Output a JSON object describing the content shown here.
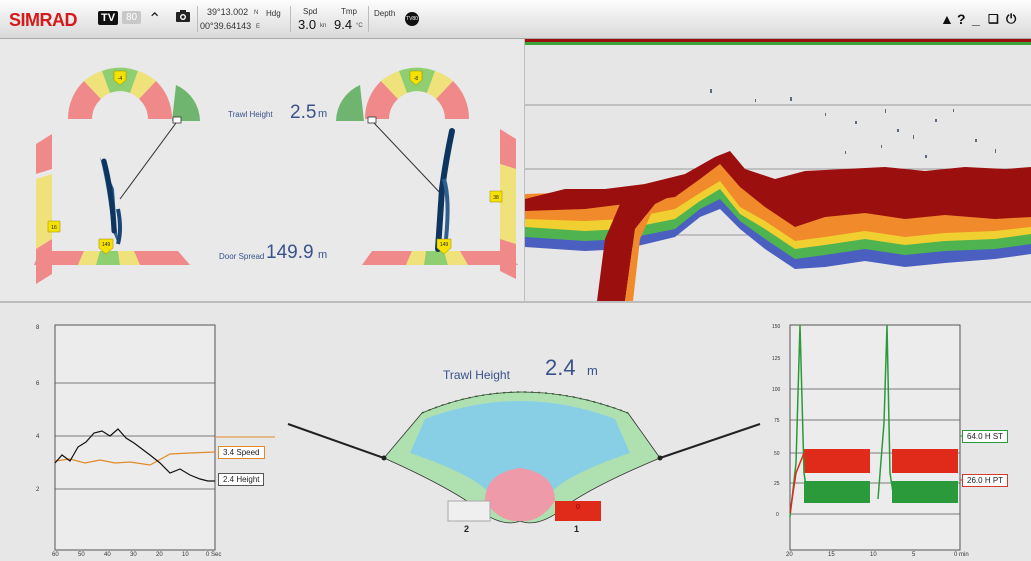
{
  "topbar": {
    "brand": "SIMRAD",
    "brand_badge": "TV",
    "brand_badge2": "80",
    "lat": "39°13.002",
    "lat_hem": "N",
    "lon": "00°39.64143",
    "lon_hem": "E",
    "hdg_label": "Hdg",
    "spd_label": "Spd",
    "spd_value": "3.0",
    "spd_unit": "kn",
    "tmp_label": "Tmp",
    "tmp_value": "9.4",
    "tmp_unit": "°C",
    "depth_label": "Depth",
    "depth_icon_text": "TV80",
    "icons": [
      "chevron-up-icon",
      "camera-icon",
      "warning-icon",
      "help-icon",
      "minimize-icon",
      "restore-icon",
      "power-icon"
    ]
  },
  "trawl_top": {
    "trawl_height_label": "Trawl Height",
    "trawl_height_value": "2.5",
    "trawl_height_unit": "m",
    "door_spread_label": "Door Spread",
    "door_spread_value": "149.9",
    "door_spread_unit": "m",
    "left_door": {
      "top_marker": "-4",
      "side_marker": "16",
      "bottom_marker": "149"
    },
    "right_door": {
      "top_marker": "-8",
      "side_marker": "38",
      "bottom_marker": "149"
    }
  },
  "history_left": {
    "y_ticks": [
      "8",
      "6",
      "4",
      "2"
    ],
    "x_ticks": [
      "60",
      "50",
      "40",
      "30",
      "20",
      "10",
      "0 Sec"
    ],
    "legend": [
      {
        "value": "3.4",
        "name": "Speed",
        "color": "#e08a2a"
      },
      {
        "value": "2.4",
        "name": "Height",
        "color": "#111111"
      }
    ]
  },
  "trawl_center": {
    "label": "Trawl Height",
    "value": "2.4",
    "unit": "m",
    "sensor_2_label": "2",
    "sensor_1_label": "1",
    "sensor_1_value": "0"
  },
  "history_right": {
    "y_ticks": [
      "150",
      "125",
      "100",
      "75",
      "50",
      "25",
      "0"
    ],
    "x_ticks": [
      "20",
      "15",
      "10",
      "5",
      "0 min"
    ],
    "legend": [
      {
        "value": "64.0",
        "name": "H ST",
        "color": "#2a9a3a"
      },
      {
        "value": "26.0",
        "name": "H PT",
        "color": "#d43a2a"
      }
    ]
  },
  "colors": {
    "brand": "#d41a1a",
    "text_blue": "#39538b",
    "echo_red": "#9c0f0f",
    "green": "#2a9a3a",
    "red": "#e02a1a"
  }
}
